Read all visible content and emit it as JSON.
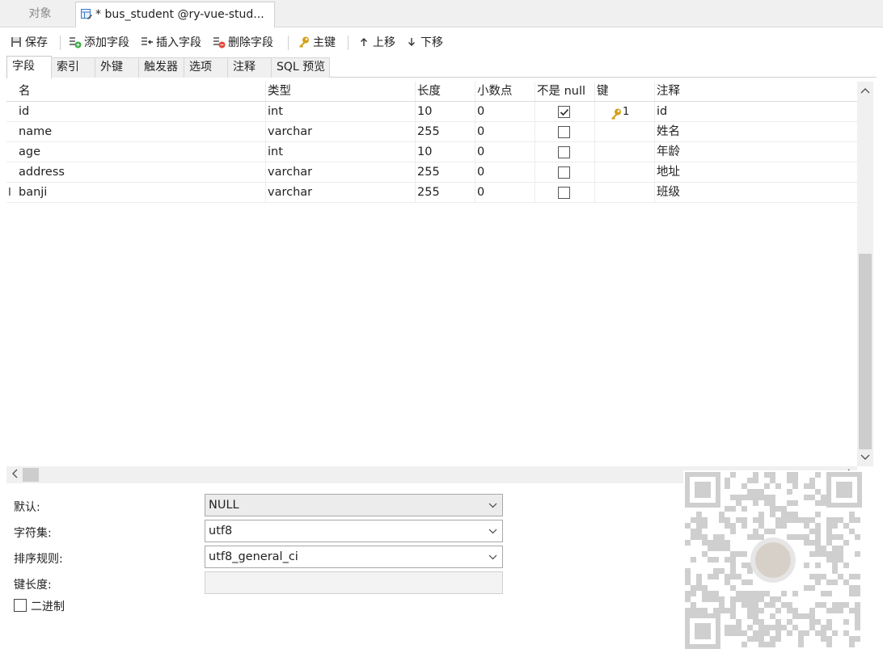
{
  "document_tabs": [
    {
      "label": "对象",
      "active": false
    },
    {
      "label": "* bus_student @ry-vue-stud...",
      "active": true
    }
  ],
  "toolbar": {
    "save": "保存",
    "add_field": "添加字段",
    "insert_field": "插入字段",
    "delete_field": "删除字段",
    "primary_key": "主键",
    "move_up": "上移",
    "move_down": "下移"
  },
  "sub_tabs": [
    "字段",
    "索引",
    "外键",
    "触发器",
    "选项",
    "注释",
    "SQL 预览"
  ],
  "grid": {
    "headers": {
      "name": "名",
      "type": "类型",
      "length": "长度",
      "decimals": "小数点",
      "not_null": "不是 null",
      "key": "键",
      "comment": "注释"
    },
    "rows": [
      {
        "name": "id",
        "type": "int",
        "length": "10",
        "decimals": "0",
        "not_null": true,
        "key": "1",
        "comment": "id"
      },
      {
        "name": "name",
        "type": "varchar",
        "length": "255",
        "decimals": "0",
        "not_null": false,
        "key": "",
        "comment": "姓名"
      },
      {
        "name": "age",
        "type": "int",
        "length": "10",
        "decimals": "0",
        "not_null": false,
        "key": "",
        "comment": "年龄"
      },
      {
        "name": "address",
        "type": "varchar",
        "length": "255",
        "decimals": "0",
        "not_null": false,
        "key": "",
        "comment": "地址"
      },
      {
        "name": "banji",
        "type": "varchar",
        "length": "255",
        "decimals": "0",
        "not_null": false,
        "key": "",
        "comment": "班级"
      }
    ],
    "cursor_glyph": "I"
  },
  "properties": {
    "default_label": "默认:",
    "default_value": "NULL",
    "charset_label": "字符集:",
    "charset_value": "utf8",
    "collation_label": "排序规则:",
    "collation_value": "utf8_general_ci",
    "key_length_label": "键长度:",
    "key_length_value": "",
    "binary_label": "二进制",
    "binary_checked": false
  },
  "colors": {
    "tab_bar_bg": "#f0f0f0",
    "key_icon": "#d4a017",
    "remove_icon": "#e04b3c",
    "add_icon": "#3fae49"
  },
  "icons": {
    "table_tab": "table-edit-icon",
    "save": "save-icon",
    "add_field": "add-field-icon",
    "insert_field": "insert-field-icon",
    "delete_field": "delete-field-icon",
    "primary_key": "key-icon",
    "move_up": "arrow-up-icon",
    "move_down": "arrow-down-icon"
  }
}
